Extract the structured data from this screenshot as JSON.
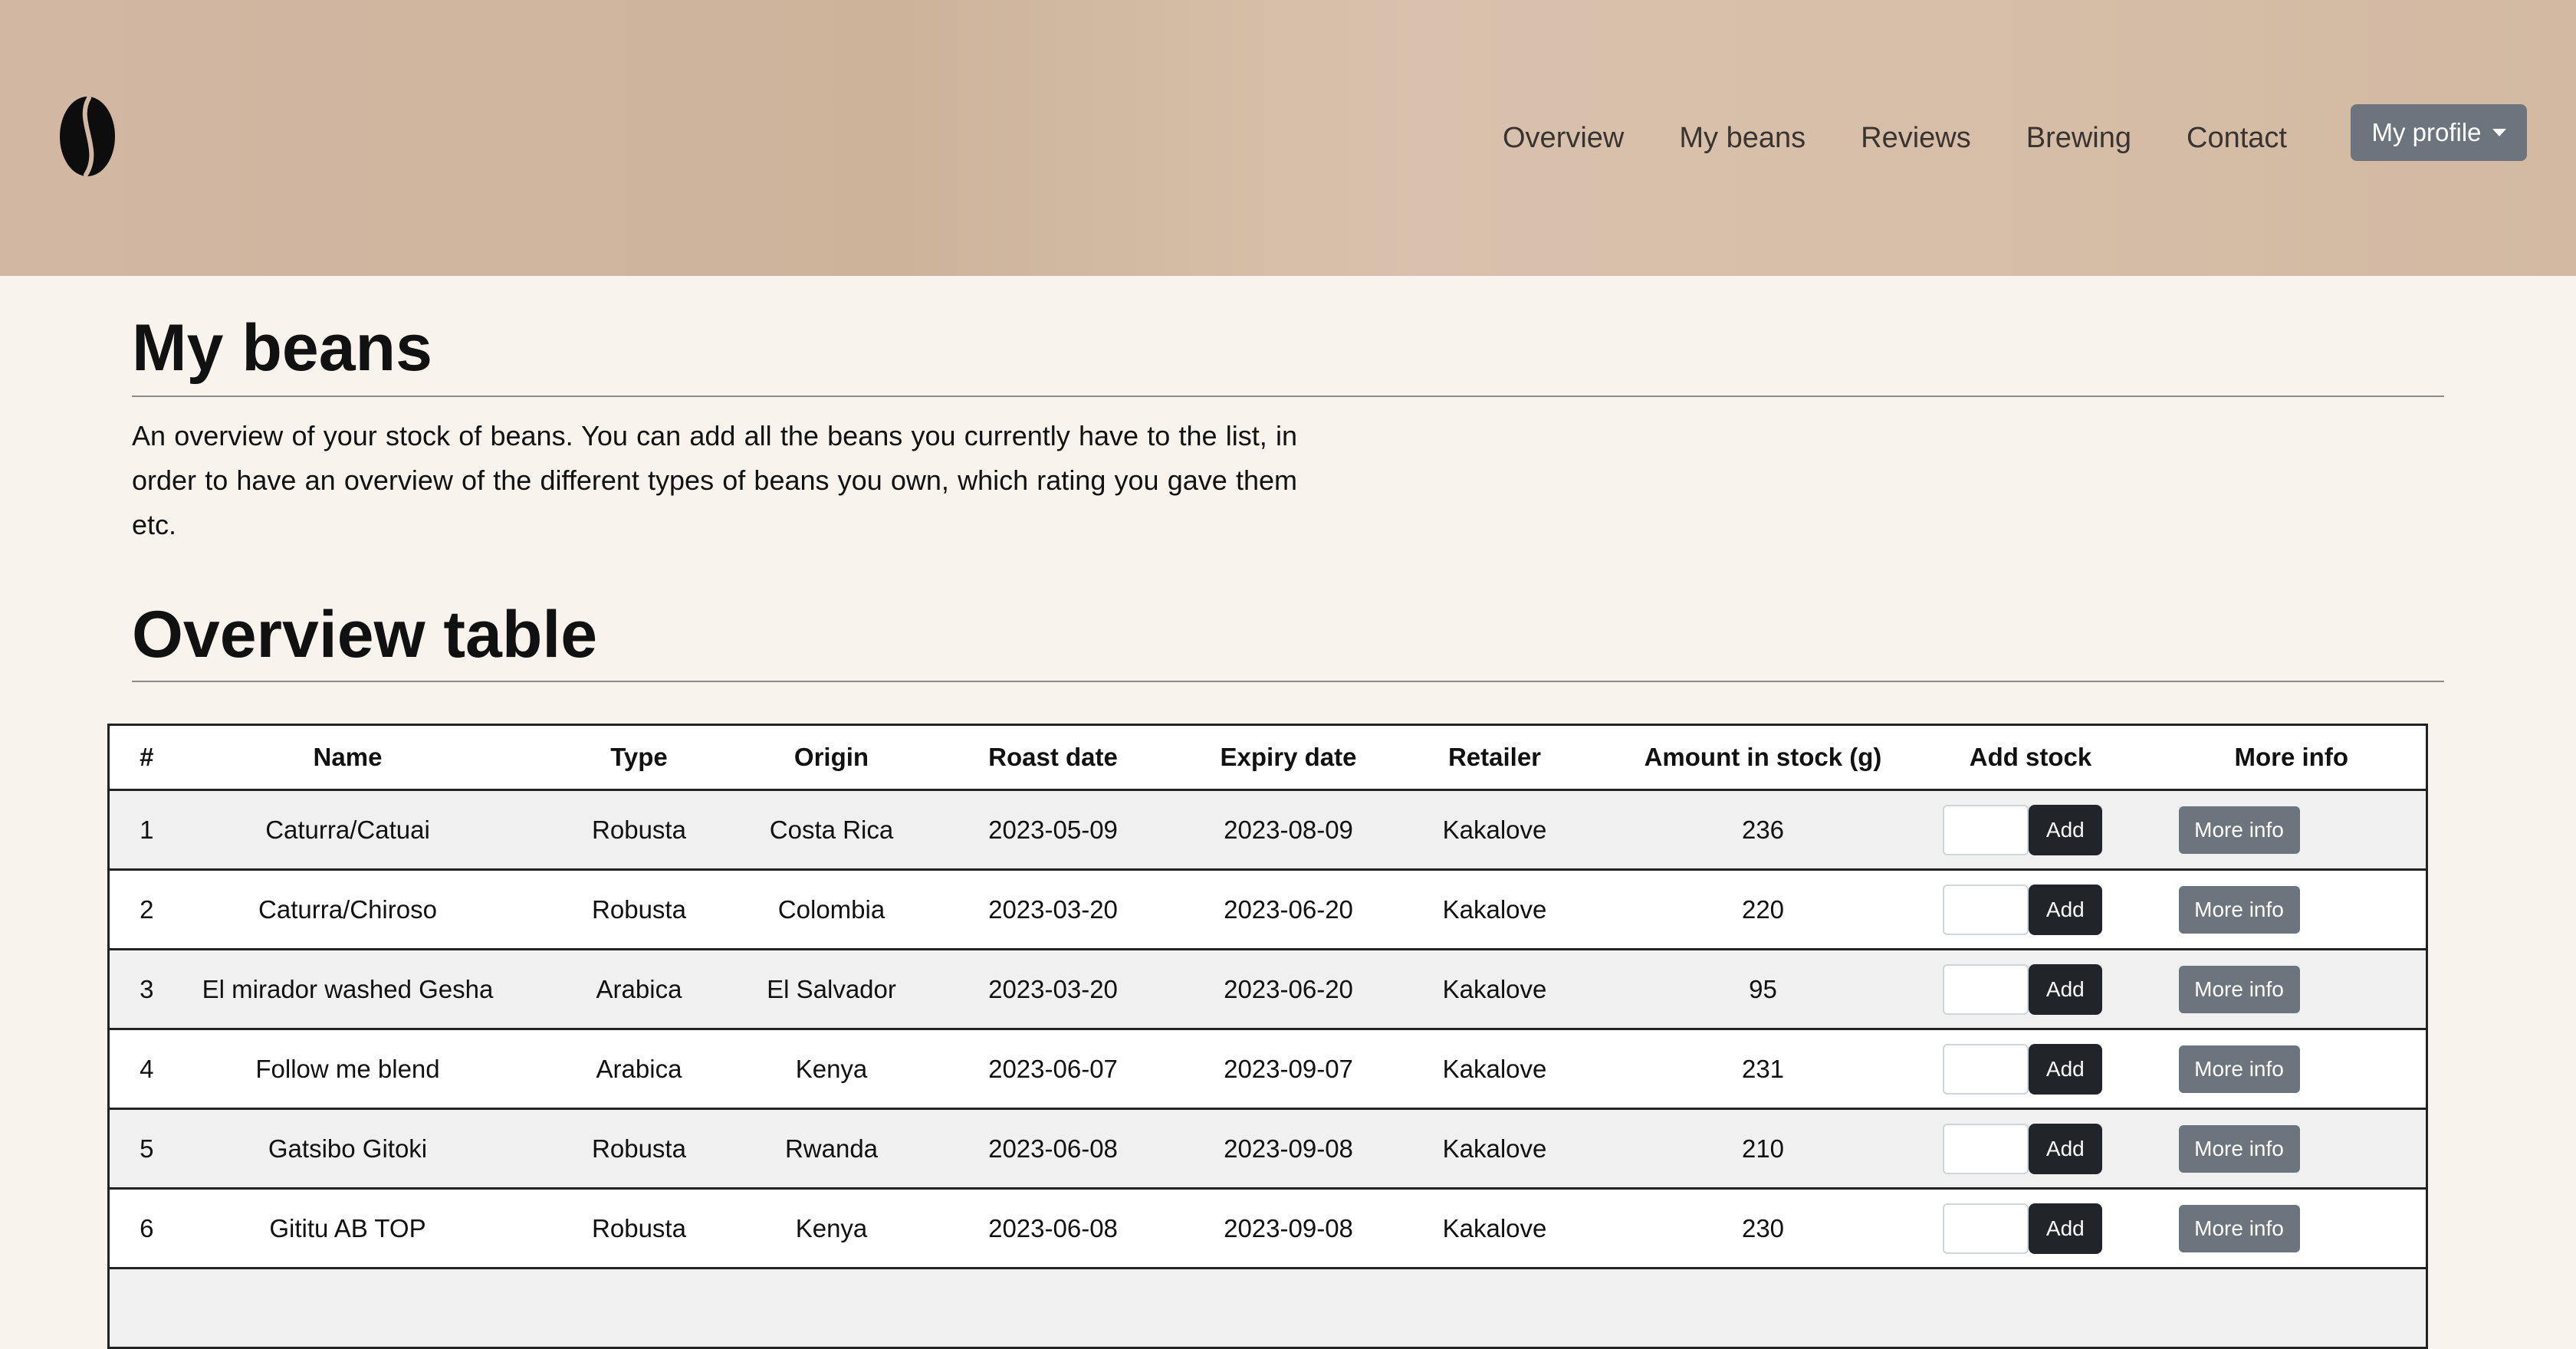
{
  "nav": {
    "links": [
      "Overview",
      "My beans",
      "Reviews",
      "Brewing",
      "Contact"
    ],
    "profile_label": "My profile"
  },
  "page": {
    "title": "My beans",
    "intro": "An overview of your stock of beans. You can add all the beans you currently have to the list, in order to have an overview of the different types of beans you own, which rating you gave them etc.",
    "section_title": "Overview table"
  },
  "table": {
    "headers": [
      "#",
      "Name",
      "Type",
      "Origin",
      "Roast date",
      "Expiry date",
      "Retailer",
      "Amount in stock (g)",
      "Add stock",
      "More info"
    ],
    "add_label": "Add",
    "more_label": "More info",
    "rows": [
      {
        "num": "1",
        "name": "Caturra/Catuai",
        "type": "Robusta",
        "origin": "Costa Rica",
        "roast": "2023-05-09",
        "expiry": "2023-08-09",
        "retailer": "Kakalove",
        "amount": "236"
      },
      {
        "num": "2",
        "name": "Caturra/Chiroso",
        "type": "Robusta",
        "origin": "Colombia",
        "roast": "2023-03-20",
        "expiry": "2023-06-20",
        "retailer": "Kakalove",
        "amount": "220"
      },
      {
        "num": "3",
        "name": "El mirador washed Gesha",
        "type": "Arabica",
        "origin": "El Salvador",
        "roast": "2023-03-20",
        "expiry": "2023-06-20",
        "retailer": "Kakalove",
        "amount": "95"
      },
      {
        "num": "4",
        "name": "Follow me blend",
        "type": "Arabica",
        "origin": "Kenya",
        "roast": "2023-06-07",
        "expiry": "2023-09-07",
        "retailer": "Kakalove",
        "amount": "231"
      },
      {
        "num": "5",
        "name": "Gatsibo Gitoki",
        "type": "Robusta",
        "origin": "Rwanda",
        "roast": "2023-06-08",
        "expiry": "2023-09-08",
        "retailer": "Kakalove",
        "amount": "210"
      },
      {
        "num": "6",
        "name": "Gititu AB TOP",
        "type": "Robusta",
        "origin": "Kenya",
        "roast": "2023-06-08",
        "expiry": "2023-09-08",
        "retailer": "Kakalove",
        "amount": "230"
      },
      {
        "num": "",
        "name": "",
        "type": "",
        "origin": "",
        "roast": "",
        "expiry": "",
        "retailer": "",
        "amount": ""
      }
    ]
  },
  "icons": {
    "logo": "coffee-bean-icon",
    "profile_caret": "caret-down-icon"
  },
  "colors": {
    "header_bg": "#d2b8a3",
    "page_bg": "#f8f3ec",
    "dark_button": "#212529",
    "secondary_button": "#6c757d"
  }
}
